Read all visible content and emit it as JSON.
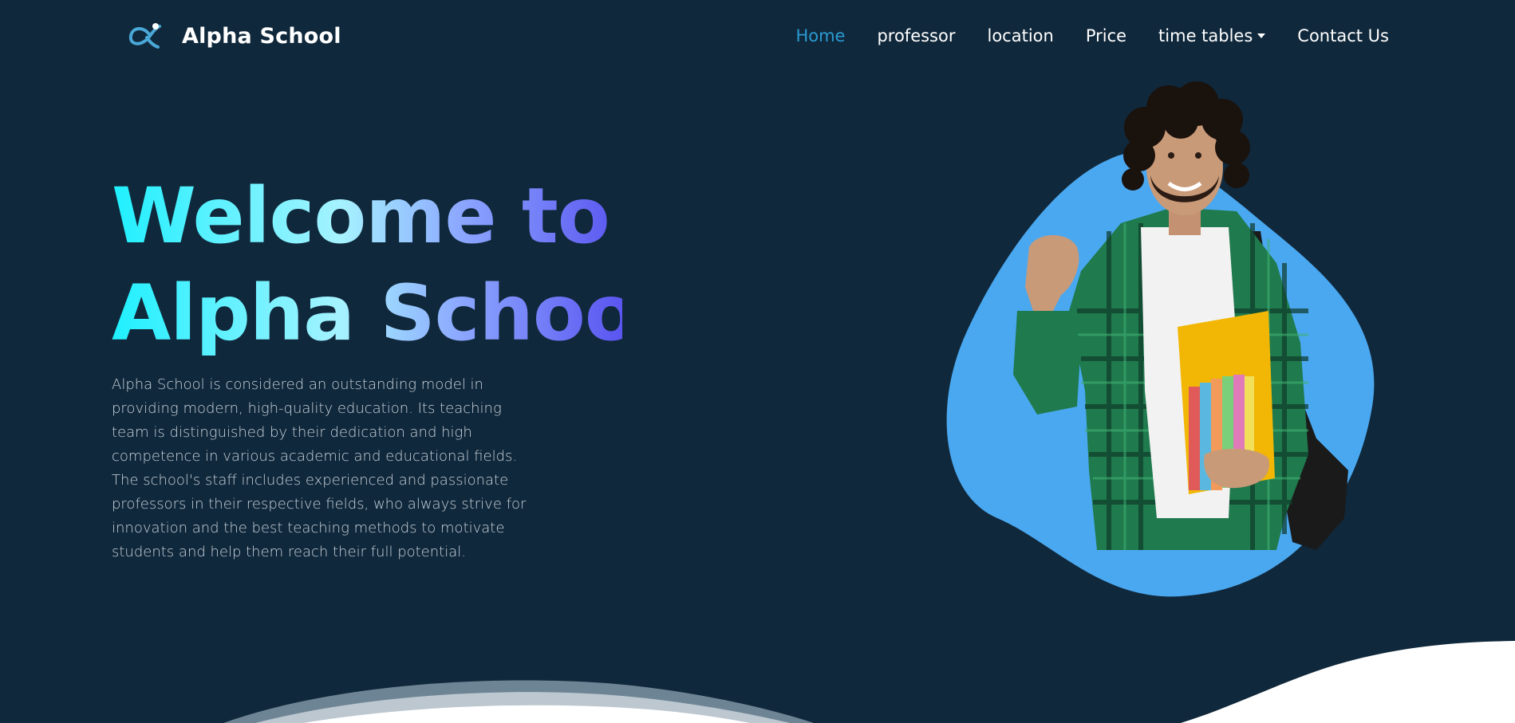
{
  "brand": {
    "name": "Alpha School",
    "logo_icon": "alpha-logo-icon"
  },
  "nav": {
    "items": [
      {
        "label": "Home",
        "active": true
      },
      {
        "label": "professor",
        "active": false
      },
      {
        "label": "location",
        "active": false
      },
      {
        "label": "Price",
        "active": false
      },
      {
        "label": "time tables",
        "active": false,
        "dropdown": true
      },
      {
        "label": "Contact Us",
        "active": false
      }
    ]
  },
  "hero": {
    "title_line1": "Welcome to",
    "title_line2": "Alpha School",
    "description": "Alpha School is considered an outstanding model in providing modern, high-quality education. Its teaching team is distinguished by their dedication and high competence in various academic and educational fields. The school's staff includes experienced and passionate professors in their respective fields, who always strive for innovation and the best teaching methods to motivate students and help them reach their full potential.",
    "image_icon": "student-photo"
  },
  "colors": {
    "background": "#10283b",
    "accent": "#2a9bd3",
    "blob": "#4aa8f0",
    "gradient_start": "#1ff0ff",
    "gradient_end": "#5a55f0"
  }
}
